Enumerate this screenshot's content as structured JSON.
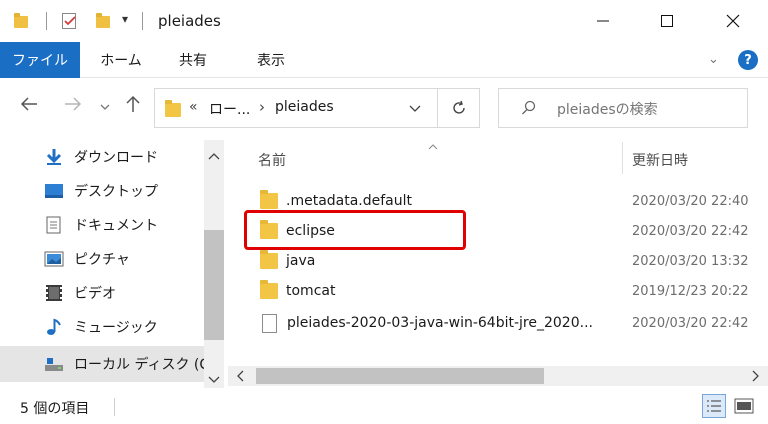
{
  "window": {
    "title": "pleiades"
  },
  "ribbon": {
    "tabs": [
      "ファイル",
      "ホーム",
      "共有",
      "表示"
    ],
    "help_glyph": "?"
  },
  "address": {
    "overflow": "«",
    "segment1": "ロー...",
    "separator": "›",
    "segment2": "pleiades"
  },
  "search": {
    "placeholder": "pleiadesの検索"
  },
  "nav_pane": {
    "items": [
      {
        "label": "ダウンロード",
        "icon": "download-icon"
      },
      {
        "label": "デスクトップ",
        "icon": "desktop-icon"
      },
      {
        "label": "ドキュメント",
        "icon": "document-icon"
      },
      {
        "label": "ピクチャ",
        "icon": "picture-icon"
      },
      {
        "label": "ビデオ",
        "icon": "video-icon"
      },
      {
        "label": "ミュージック",
        "icon": "music-icon"
      },
      {
        "label": "ローカル ディスク (C",
        "icon": "drive-icon"
      }
    ]
  },
  "file_list": {
    "columns": {
      "name": "名前",
      "modified": "更新日時"
    },
    "rows": [
      {
        "name": ".metadata.default",
        "modified": "2020/03/20 22:40",
        "type": "folder"
      },
      {
        "name": "eclipse",
        "modified": "2020/03/20 22:42",
        "type": "folder",
        "highlighted": true
      },
      {
        "name": "java",
        "modified": "2020/03/20 13:32",
        "type": "folder"
      },
      {
        "name": "tomcat",
        "modified": "2019/12/23 20:22",
        "type": "folder"
      },
      {
        "name": "pleiades-2020-03-java-win-64bit-jre_2020...",
        "modified": "2020/03/20 22:42",
        "type": "file"
      }
    ]
  },
  "status": {
    "item_count": "5 個の項目"
  },
  "colors": {
    "accent": "#1a6fc4",
    "highlight": "#e00000",
    "folder": "#f2c544"
  }
}
